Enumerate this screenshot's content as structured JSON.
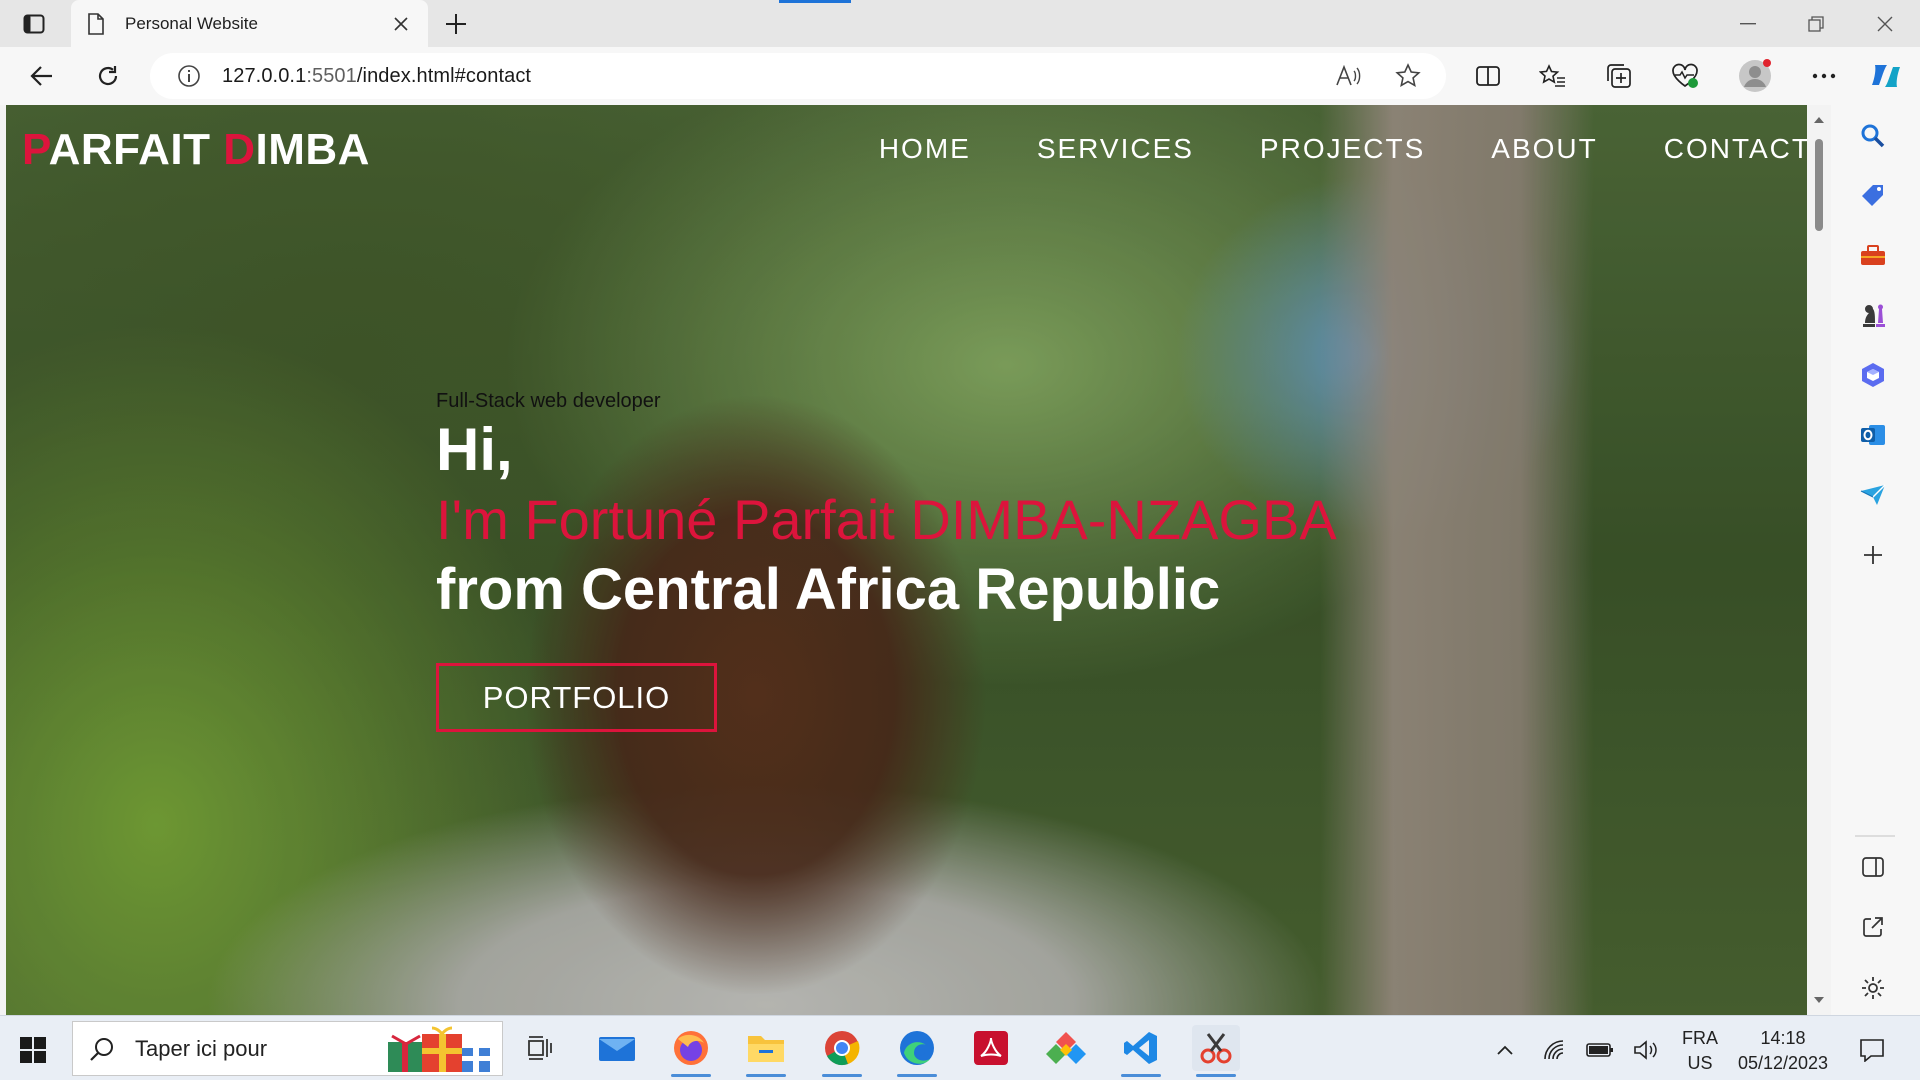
{
  "browser": {
    "tab": {
      "title": "Personal Website"
    },
    "address": {
      "scheme_host": "127.0.0.1",
      "port": ":5501",
      "path": "/index.html#contact"
    }
  },
  "site": {
    "logo": {
      "first_initial": "P",
      "first_rest": "ARFAIT ",
      "last_initial": "D",
      "last_rest": "IMBA"
    },
    "nav": [
      "HOME",
      "SERVICES",
      "PROJECTS",
      "ABOUT",
      "CONTACT"
    ],
    "hero": {
      "subtitle": "Full-Stack web developer",
      "line1": "Hi,",
      "line2": "I'm Fortuné Parfait DIMBA-NZAGBA",
      "line3": "from Central Africa Republic",
      "button": "PORTFOLIO"
    }
  },
  "taskbar": {
    "search_text": "Taper ici pour",
    "lang_top": "FRA",
    "lang_bottom": "US",
    "time": "14:18",
    "date": "05/12/2023"
  },
  "colors": {
    "accent_red": "#dc143c",
    "edge_blue": "#1e73d8"
  }
}
